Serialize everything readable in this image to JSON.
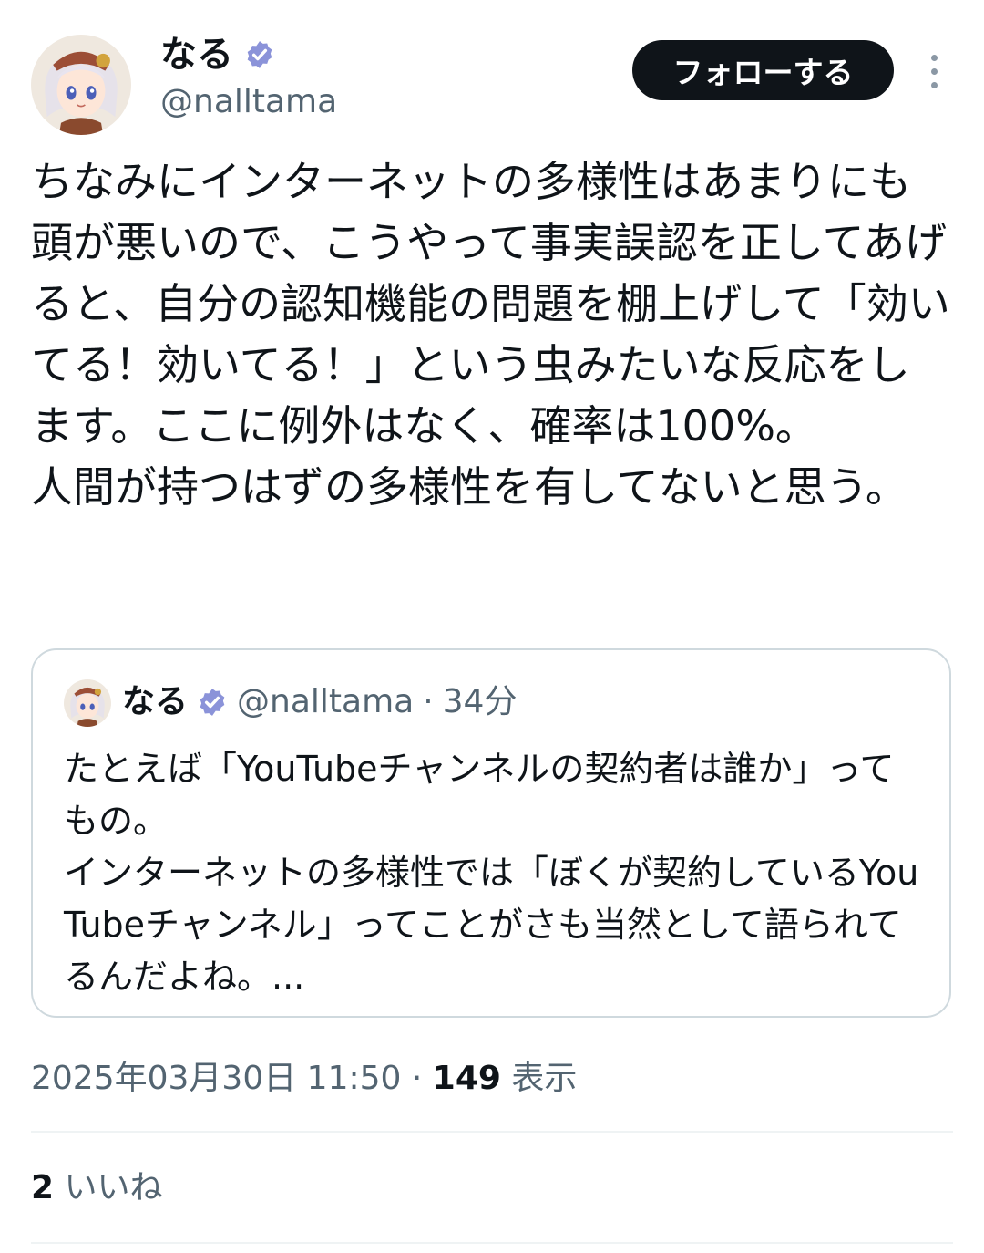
{
  "author": {
    "display_name": "なる",
    "handle": "@nalltama",
    "avatar_icon": "anime-girl-avatar",
    "verified_icon": "verified-badge-icon"
  },
  "actions": {
    "follow_label": "フォローする",
    "more_icon": "more-vertical-icon"
  },
  "tweet": {
    "text": "ちなみにインターネットの多様性はあまりにも頭が悪いので、こうやって事実誤認を正してあげると、自分の認知機能の問題を棚上げして「効いてる！効いてる！」という虫みたいな反応をします。ここに例外はなく、確率は100%。\n人間が持つはずの多様性を有してないと思う。"
  },
  "quote": {
    "display_name": "なる",
    "handle": "@nalltama",
    "separator": "·",
    "time": "34分",
    "text": "たとえば「YouTubeチャンネルの契約者は誰か」ってもの。\nインターネットの多様性では「ぼくが契約しているYouTubeチャンネル」ってことがさも当然として語られてるんだよね。..."
  },
  "meta": {
    "timestamp": "2025年03月30日 11:50",
    "separator": "·",
    "views_count": "149",
    "views_label": "表示"
  },
  "likes": {
    "count": "2",
    "label": "いいね"
  },
  "colors": {
    "primary_text": "#0f1419",
    "secondary_text": "#536471",
    "follow_button_bg": "#0f1419",
    "verified_badge": "#8b93d9",
    "border": "#cfd9de",
    "divider": "#eff3f4"
  }
}
